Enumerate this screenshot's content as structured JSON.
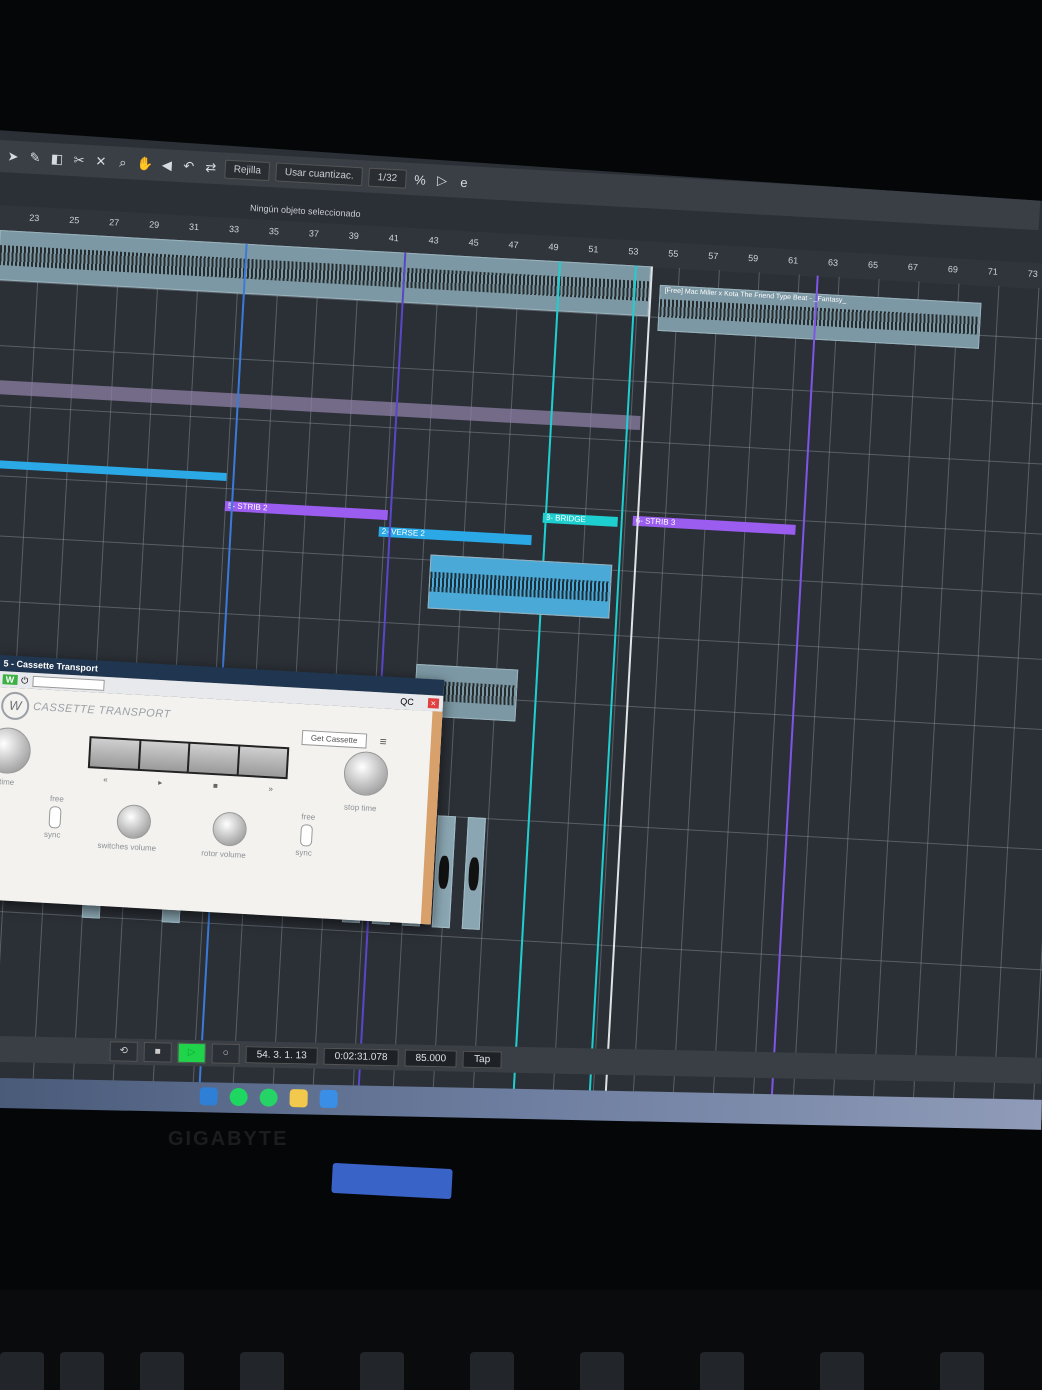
{
  "toolbar": {
    "grid_label": "Rejilla",
    "quantize_label": "Usar cuantizac.",
    "quantize_value": "1/32",
    "status": "Ningún objeto seleccionado"
  },
  "ruler": {
    "bars": [
      "23",
      "25",
      "27",
      "29",
      "31",
      "33",
      "35",
      "37",
      "39",
      "41",
      "43",
      "45",
      "47",
      "49",
      "51",
      "53",
      "55",
      "57",
      "59",
      "61",
      "63",
      "65",
      "67",
      "69",
      "71",
      "73"
    ]
  },
  "tracks": {
    "audio_clip_title": "[Free] Mac Miller x Kota The Friend Type Beat - _Fantasy_",
    "markers": [
      "5- STRIB 2",
      "2- VERSE 2",
      "8- BRIDGE",
      "6- STRIB 3"
    ]
  },
  "plugin": {
    "window_title": "5 - Cassette Transport",
    "bar_w": "W",
    "bar_qc": "QC",
    "brand": "CASSETTE TRANSPORT",
    "get_button": "Get Cassette",
    "key_labels": [
      "«",
      "▸",
      "■",
      "»"
    ],
    "labels": {
      "play_time": "y time",
      "stop_time": "stop time",
      "free_left": "free",
      "sync_left": "sync",
      "free_right": "free",
      "sync_right": "sync",
      "switches_volume": "switches volume",
      "rotor_volume": "rotor volume"
    }
  },
  "transport": {
    "position": "54. 3. 1. 13",
    "time": "0:02:31.078",
    "tempo": "85.000",
    "tap": "Tap"
  },
  "monitor": {
    "brand": "GIGABYTE"
  }
}
